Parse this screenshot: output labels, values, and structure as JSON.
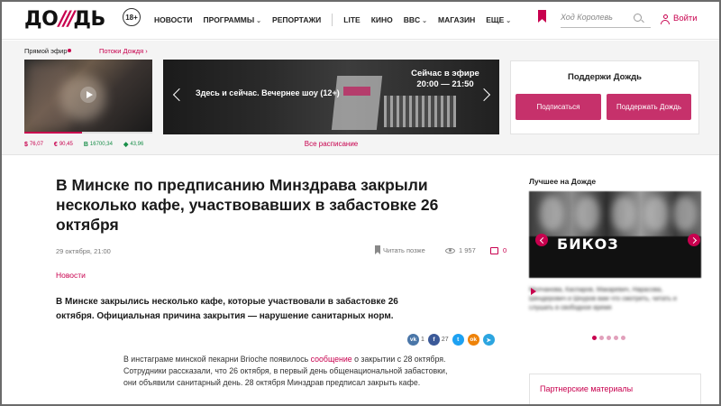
{
  "header": {
    "logo": {
      "left": "ДО",
      "slashes": "///",
      "right": "ДЬ"
    },
    "age_badge": "18+",
    "nav": [
      {
        "label": "НОВОСТИ",
        "dropdown": false
      },
      {
        "label": "ПРОГРАММЫ",
        "dropdown": true
      },
      {
        "label": "РЕПОРТАЖИ",
        "dropdown": false
      },
      {
        "label": "LITE",
        "dropdown": false
      },
      {
        "label": "КИНО",
        "dropdown": false
      },
      {
        "label": "BBC",
        "dropdown": true
      },
      {
        "label": "МАГАЗИН",
        "dropdown": false
      },
      {
        "label": "ЕЩЕ",
        "dropdown": true
      }
    ],
    "search_placeholder": "Ход Королевь",
    "login": "Войти"
  },
  "live": {
    "label": "Прямой эфир",
    "streams_link": "Потоки Дождя",
    "progress_fraction": 0.45,
    "quotes": [
      {
        "symbol": "$",
        "value": "76,07",
        "color": "#c8004e"
      },
      {
        "symbol": "€",
        "value": "90,45",
        "color": "#c8004e"
      },
      {
        "symbol": "B",
        "value": "16700,34",
        "color": "#1a8f4a"
      },
      {
        "symbol": "◆",
        "value": "43,96",
        "color": "#1a8f4a"
      }
    ]
  },
  "slider": {
    "title": "Здесь и сейчас. Вечернее шоу (12+)",
    "on_air_label": "Сейчас в эфире",
    "on_air_time": "20:00 — 21:50",
    "schedule_link": "Все расписание"
  },
  "support": {
    "title": "Поддержи Дождь",
    "subscribe": "Подписаться",
    "donate": "Поддержать Дождь"
  },
  "article": {
    "title": "В Минске по предписанию Минздрава закрыли несколько кафе, участвовавших в забастовке 26 октября",
    "date": "29 октября, 21:00",
    "read_later": "Читать позже",
    "views": "1 957",
    "comments": "0",
    "category": "Новости",
    "lead": "В Минске закрылись несколько кафе, которые участвовали в забастовке 26 октября. Официальная причина закрытия — нарушение санитарных норм.",
    "share": {
      "vk_count": "1",
      "fb_count": "27"
    },
    "body_before_link": "В инстаграме минской пекарни Brioche появилось ",
    "body_link": "сообщение",
    "body_after_link": " о закрытии с 28 октября. Сотрудники рассказали, что 26 октября, в первый день общенациональной забастовки, они объявили санитарный день. 28 октября Минздрав предписал закрыть кафе."
  },
  "sidebar": {
    "best_title": "Лучшее на Дожде",
    "best_caption": "БИКОЗ",
    "best_desc": "Молчанова, Каспаров, Макаревич, Нарасова, Шендерович и Шнуров вам что смотреть, читать и слушать в свободное время",
    "partner_title": "Партнерские материалы"
  }
}
